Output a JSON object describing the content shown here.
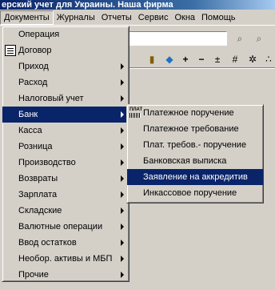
{
  "window": {
    "title": "ерский учет для Украины. Наша фирма"
  },
  "menubar": {
    "items": [
      {
        "label": "Документы",
        "active": true
      },
      {
        "label": "Журналы"
      },
      {
        "label": "Отчеты"
      },
      {
        "label": "Сервис"
      },
      {
        "label": "Окна"
      },
      {
        "label": "Помощь"
      }
    ]
  },
  "documents_menu": {
    "items": [
      {
        "label": "Операция",
        "submenu": false
      },
      {
        "label": "Договор",
        "submenu": false,
        "icon": "document-icon"
      },
      {
        "label": "Приход",
        "submenu": true
      },
      {
        "label": "Расход",
        "submenu": true
      },
      {
        "label": "Налоговый учет",
        "submenu": true
      },
      {
        "label": "Банк",
        "submenu": true,
        "selected": true
      },
      {
        "label": "Касса",
        "submenu": true
      },
      {
        "label": "Розница",
        "submenu": true
      },
      {
        "label": "Производство",
        "submenu": true
      },
      {
        "label": "Возвраты",
        "submenu": true
      },
      {
        "label": "Зарплата",
        "submenu": true
      },
      {
        "label": "Складские",
        "submenu": true
      },
      {
        "label": "Валютные операции",
        "submenu": true
      },
      {
        "label": "Ввод остатков",
        "submenu": true
      },
      {
        "label": "Необор. активы и МБП",
        "submenu": true
      },
      {
        "label": "Прочие",
        "submenu": true
      }
    ]
  },
  "bank_submenu": {
    "items": [
      {
        "label": "Платежное поручение",
        "icon": "payment-order-icon",
        "icon_text": "ПЛАТ"
      },
      {
        "label": "Платежное требование"
      },
      {
        "label": "Плат. требов.- поручение"
      },
      {
        "label": "Банковская выписка"
      },
      {
        "label": "Заявление на аккредитив",
        "selected": true
      },
      {
        "label": "Инкассовое поручение"
      }
    ]
  },
  "colors": {
    "menu_bg": "#d4d0c8",
    "highlight": "#0a246a",
    "title_bar": "#0a246a"
  }
}
